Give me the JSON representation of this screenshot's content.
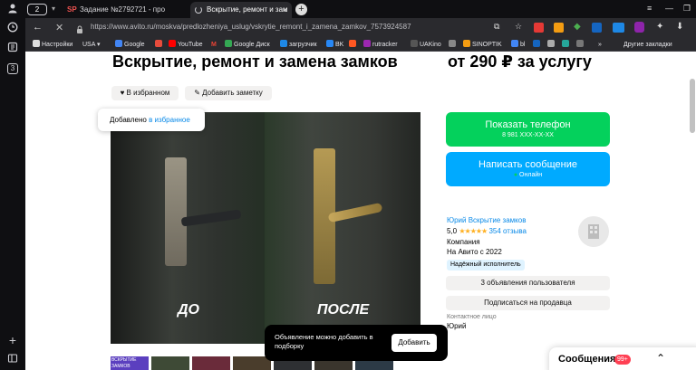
{
  "browser": {
    "tab_counter": "2",
    "tabs": [
      {
        "favicon": "SP",
        "title": "Задание №2792721 - про"
      },
      {
        "title": "Вскрытие, ремонт и зам"
      }
    ],
    "new_tab_icon": "plus-icon",
    "url": "https://www.avito.ru/moskva/predlozheniya_uslug/vskrytie_remont_i_zamena_zamkov_7573924587",
    "bookmarks": [
      {
        "label": "Настройки",
        "color": "#dddddd"
      },
      {
        "label": "USA",
        "color": "#cccccc"
      },
      {
        "label": "Google",
        "color": "#4285f4"
      },
      {
        "label": "",
        "color": "#e74c3c"
      },
      {
        "label": "YouTube",
        "color": "#ff0000"
      },
      {
        "label": "M",
        "color": "#ea4335"
      },
      {
        "label": "Google Диск",
        "color": "#34a853"
      },
      {
        "label": "загрузчик",
        "color": "#1e88e5"
      },
      {
        "label": "BK",
        "color": "#2787f5"
      },
      {
        "label": "",
        "color": "#ff5722"
      },
      {
        "label": "rutracker",
        "color": "#9c27b0"
      },
      {
        "label": "UAKino",
        "color": "#555555"
      },
      {
        "label": "",
        "color": "#888888"
      },
      {
        "label": "SINOPTIK",
        "color": "#f39c12"
      },
      {
        "label": "bl",
        "color": "#4285f4"
      },
      {
        "label": "P",
        "color": "#1565c0"
      }
    ],
    "other_bookmarks": "Другие закладки",
    "side_panel_number": "3"
  },
  "listing": {
    "title": "Вскрытие, ремонт и замена замков",
    "price": "от 290 ₽ за услугу",
    "favorite_label": "В избранном",
    "note_label": "Добавить заметку",
    "toast_prefix": "Добавлено ",
    "toast_link": "в избранное",
    "photo_labels": {
      "before": "ДО",
      "after": "ПОСЛЕ"
    },
    "thumb_text": "ВСКРЫТИЕ ЗАМКОВ",
    "show_phone": "Показать телефон",
    "phone_masked": "8 981 XXX-XX-XX",
    "write_message": "Написать сообщение",
    "online": "Онлайн",
    "seller": {
      "name": "Юрий Вскрытие замков",
      "rating": "5,0",
      "stars": "★★★★★",
      "reviews": "354 отзыва",
      "type": "Компания",
      "since": "На Авито с 2022",
      "badge": "Надёжный исполнитель"
    },
    "user_ads_button": "3 объявления пользователя",
    "subscribe_button": "Подписаться на продавца",
    "contact_label": "Контактное лицо",
    "contact_name": "Юрий",
    "bundle_prompt": "Объявление можно добавить в подборку",
    "bundle_add": "Добавить",
    "messages_label": "Сообщения",
    "messages_badge": "99+"
  },
  "colors": {
    "green": "#04d15c",
    "blue": "#00aaff",
    "badge_bg": "#dff3ff",
    "seller_link": "#0a8ae8"
  }
}
